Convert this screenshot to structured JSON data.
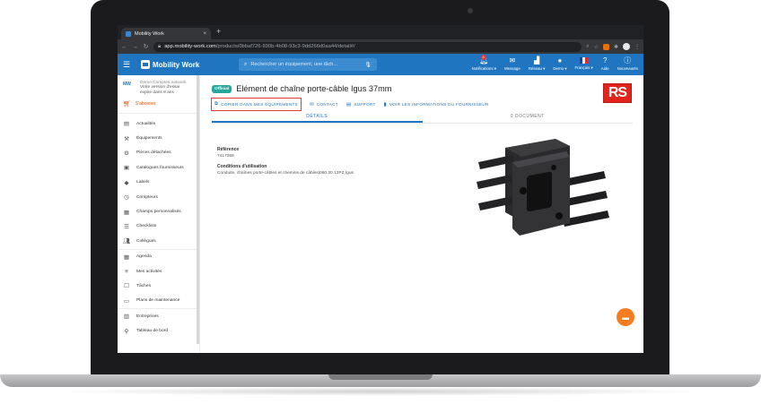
{
  "browser": {
    "tab_title": "Mobility Work",
    "tab_close": "×",
    "new_tab": "+",
    "url_host": "app.mobility-work.com",
    "url_path": "/products/0bbaf726-930b-4b08-93c3-9dd266d0aa44/detail#/"
  },
  "header": {
    "logo_text": "Mobility Work",
    "search_placeholder": "Rechercher un équipement, une tâch...",
    "notifications_badge": "4",
    "actions": [
      {
        "label": "Notifications ▾"
      },
      {
        "label": "Message"
      },
      {
        "label": "Réseau ▾"
      },
      {
        "label": "Demo ▾"
      },
      {
        "label": "Français ▾"
      },
      {
        "label": "Aide"
      },
      {
        "label": "Nouveautés"
      }
    ],
    "colors": {
      "primary": "#1f75c0"
    }
  },
  "sidebar": {
    "company_name": "Demo Comptes network",
    "company_logo_text": "MW",
    "trial_line1": "Votre version d'essai",
    "trial_line2": "expire dans 8 ans",
    "subscribe_label": "S'abonner",
    "items": [
      {
        "label": "Actualités",
        "icon": "news-icon"
      },
      {
        "label": "Équipements",
        "icon": "equipment-icon"
      },
      {
        "label": "Pièces détachées",
        "icon": "parts-icon"
      },
      {
        "label": "Catalogues fournisseurs",
        "icon": "catalog-icon"
      },
      {
        "label": "Labels",
        "icon": "label-icon"
      },
      {
        "label": "Compteurs",
        "icon": "counter-icon"
      },
      {
        "label": "Champs personnalisés",
        "icon": "custom-fields-icon"
      },
      {
        "label": "Checklists",
        "icon": "checklist-icon"
      },
      {
        "label": "Collègues",
        "icon": "colleagues-icon"
      },
      {
        "label": "Agenda",
        "icon": "calendar-icon"
      },
      {
        "label": "Mes activités",
        "icon": "activities-icon"
      },
      {
        "label": "Tâches",
        "icon": "tasks-icon"
      },
      {
        "label": "Plans de maintenance",
        "icon": "maintenance-plan-icon"
      },
      {
        "label": "Entreprises",
        "icon": "companies-icon"
      },
      {
        "label": "Tableau de bord",
        "icon": "dashboard-icon"
      }
    ]
  },
  "product": {
    "badge": "Official",
    "title": "Elément de chaîne porte-câble Igus 37mm",
    "supplier_logo": "RS",
    "actions": {
      "copy": "COPIER DANS MES ÉQUIPEMENTS",
      "contact": "CONTACT",
      "support": "SUPPORT",
      "supplier_info": "VOIR LES INFORMATIONS DU FOURNISSEUR"
    },
    "tabs": {
      "details": "DÉTAILS",
      "documents": "0 DOCUMENT"
    },
    "reference_label": "Référence",
    "reference_value": "7417359",
    "conditions_label": "Conditions d'utilisation",
    "conditions_value": "Conduite, chaînes porte-câbles et chemins de câbles|060.30.12PZ,Igus"
  }
}
